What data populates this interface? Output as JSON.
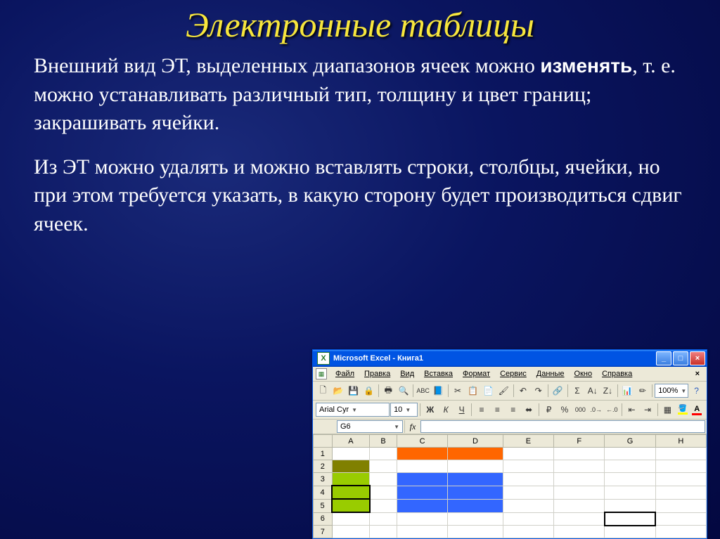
{
  "slide": {
    "title": "Электронные таблицы",
    "para1_part1": "Внешний вид ЭТ, выделенных диапазонов ячеек можно ",
    "para1_bold": "изменять",
    "para1_part2": ", т. е. можно устанавливать различный тип, толщину и цвет границ; закрашивать ячейки.",
    "para2": "Из ЭТ можно удалять и можно вставлять строки, столбцы, ячейки, но при этом требуется указать, в какую сторону будет производиться сдвиг ячеек."
  },
  "excel": {
    "app_icon_letter": "X",
    "title": "Microsoft Excel - Книга1",
    "menu": {
      "file": "Файл",
      "edit": "Правка",
      "view": "Вид",
      "insert": "Вставка",
      "format": "Формат",
      "tools": "Сервис",
      "data": "Данные",
      "window": "Окно",
      "help": "Справка"
    },
    "zoom": "100%",
    "font_name": "Arial Cyr",
    "font_size": "10",
    "name_box": "G6",
    "fx_label": "fx",
    "columns": [
      "A",
      "B",
      "C",
      "D",
      "E",
      "F",
      "G",
      "H"
    ],
    "rows": [
      "1",
      "2",
      "3",
      "4",
      "5",
      "6",
      "7"
    ],
    "toolbar_hint": {
      "bold": "Ж",
      "italic": "К",
      "underline": "Ч",
      "currency": "₽",
      "percent": "%"
    },
    "colors": {
      "fill_swatch": "#ffff00",
      "font_swatch": "#ff0000"
    }
  }
}
